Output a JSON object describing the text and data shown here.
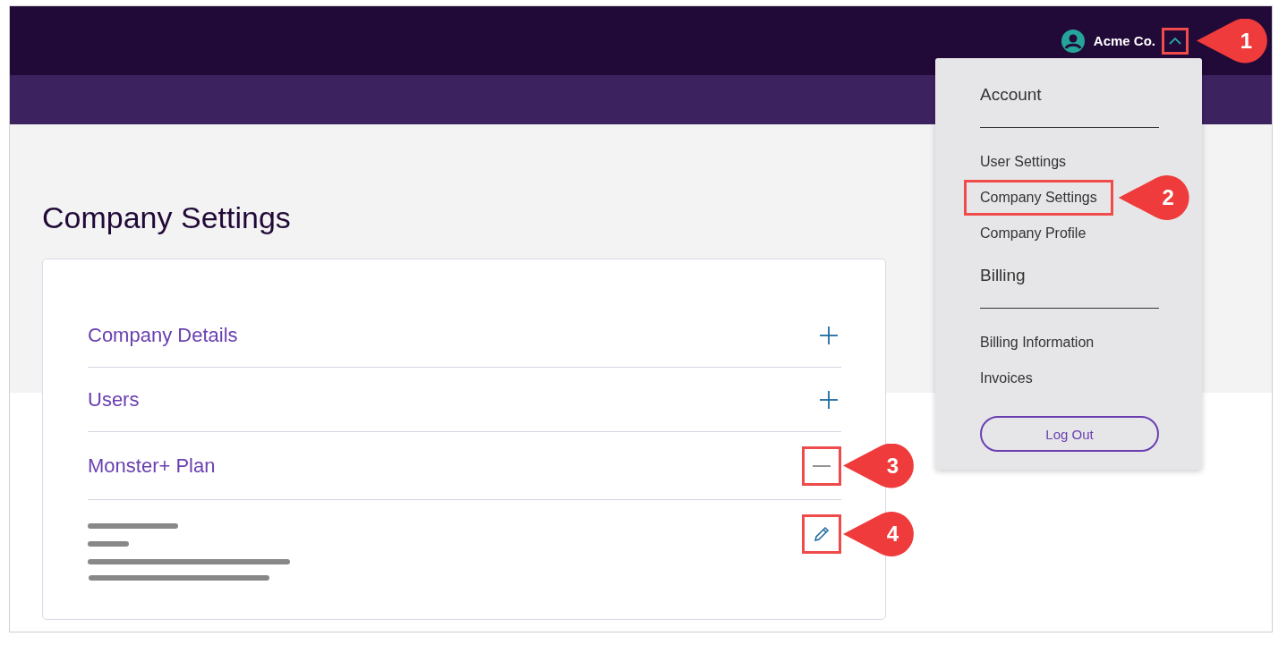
{
  "header": {
    "account_name": "Acme Co.",
    "menu_expanded": true,
    "callout": "1"
  },
  "page_title": "Company Settings",
  "sections": [
    {
      "title": "Company Details",
      "expanded": false
    },
    {
      "title": "Users",
      "expanded": false
    },
    {
      "title": "Monster+ Plan",
      "expanded": true,
      "callout": "3",
      "edit_callout": "4"
    }
  ],
  "account_menu": {
    "groups": [
      {
        "heading": "Account",
        "items": [
          {
            "label": "User Settings"
          },
          {
            "label": "Company Settings",
            "callout": "2"
          },
          {
            "label": "Company Profile"
          }
        ]
      },
      {
        "heading": "Billing",
        "items": [
          {
            "label": "Billing Information"
          },
          {
            "label": "Invoices"
          }
        ]
      }
    ],
    "button": "Log Out"
  }
}
